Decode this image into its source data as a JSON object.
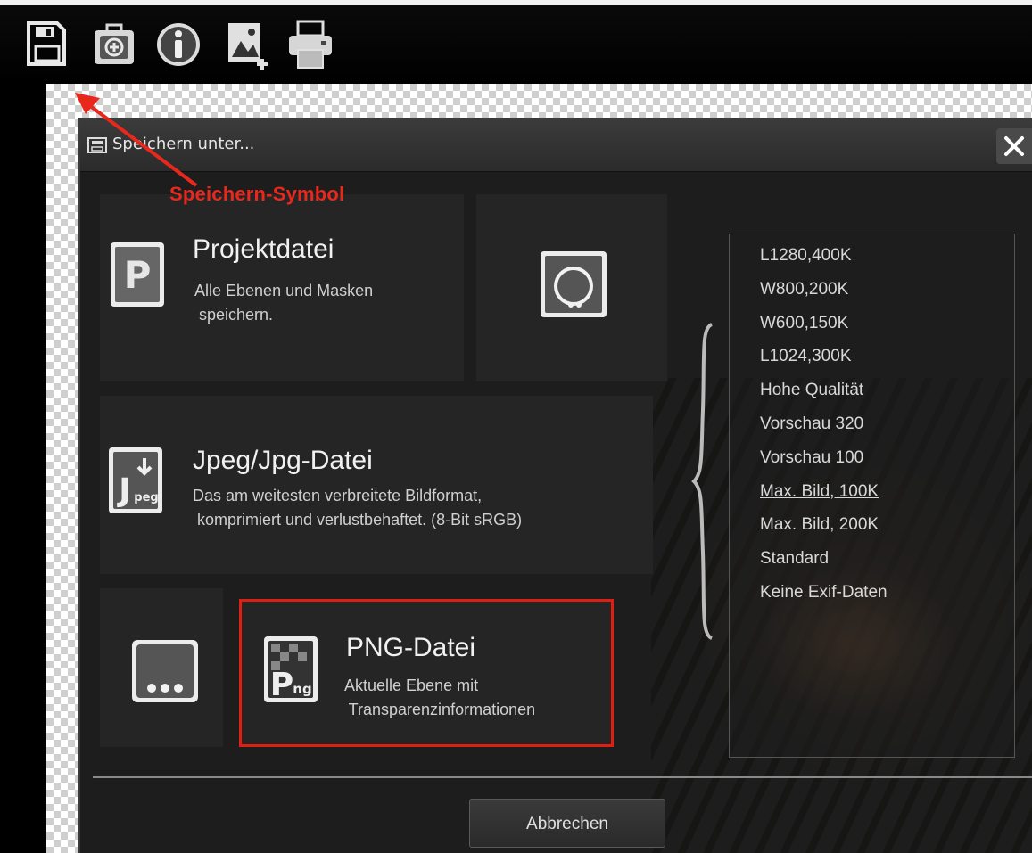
{
  "dialog": {
    "title": "Speichern unter...",
    "close_label": "✕",
    "cancel_label": "Abbrechen"
  },
  "annotation": {
    "label": "Speichern-Symbol",
    "color": "#e8281c"
  },
  "toolbar": {
    "icons": [
      "save-icon",
      "open-file-icon",
      "info-icon",
      "add-image-icon",
      "print-icon"
    ]
  },
  "options": {
    "project": {
      "title": "Projektdatei",
      "desc": "Alle Ebenen und Masken\n speichern.",
      "icon": "project-file-icon"
    },
    "jpeg": {
      "title": "Jpeg/Jpg-Datei",
      "desc": "Das am weitesten verbreitete Bildformat,\n komprimiert und verlustbehaftet. (8-Bit sRGB)",
      "icon": "jpeg-file-icon"
    },
    "png": {
      "title": "PNG-Datei",
      "desc": "Aktuelle Ebene mit\n Transparenzinformationen",
      "icon": "png-file-icon"
    },
    "circle_tile": {
      "icon": "circle-format-icon"
    },
    "more_tile": {
      "icon": "more-options-icon"
    }
  },
  "presets": [
    "L1280,400K",
    "W800,200K",
    "W600,150K",
    "L1024,300K",
    "Hohe Qualität",
    "Vorschau 320",
    "Vorschau 100",
    "Max. Bild, 100K",
    "Max. Bild, 200K",
    "Standard",
    "Keine Exif-Daten"
  ],
  "selected_preset": "Max. Bild, 100K",
  "colors": {
    "highlight": "#e01f14",
    "dialog_bg": "#1d1d1d",
    "tile_bg": "#252525"
  }
}
